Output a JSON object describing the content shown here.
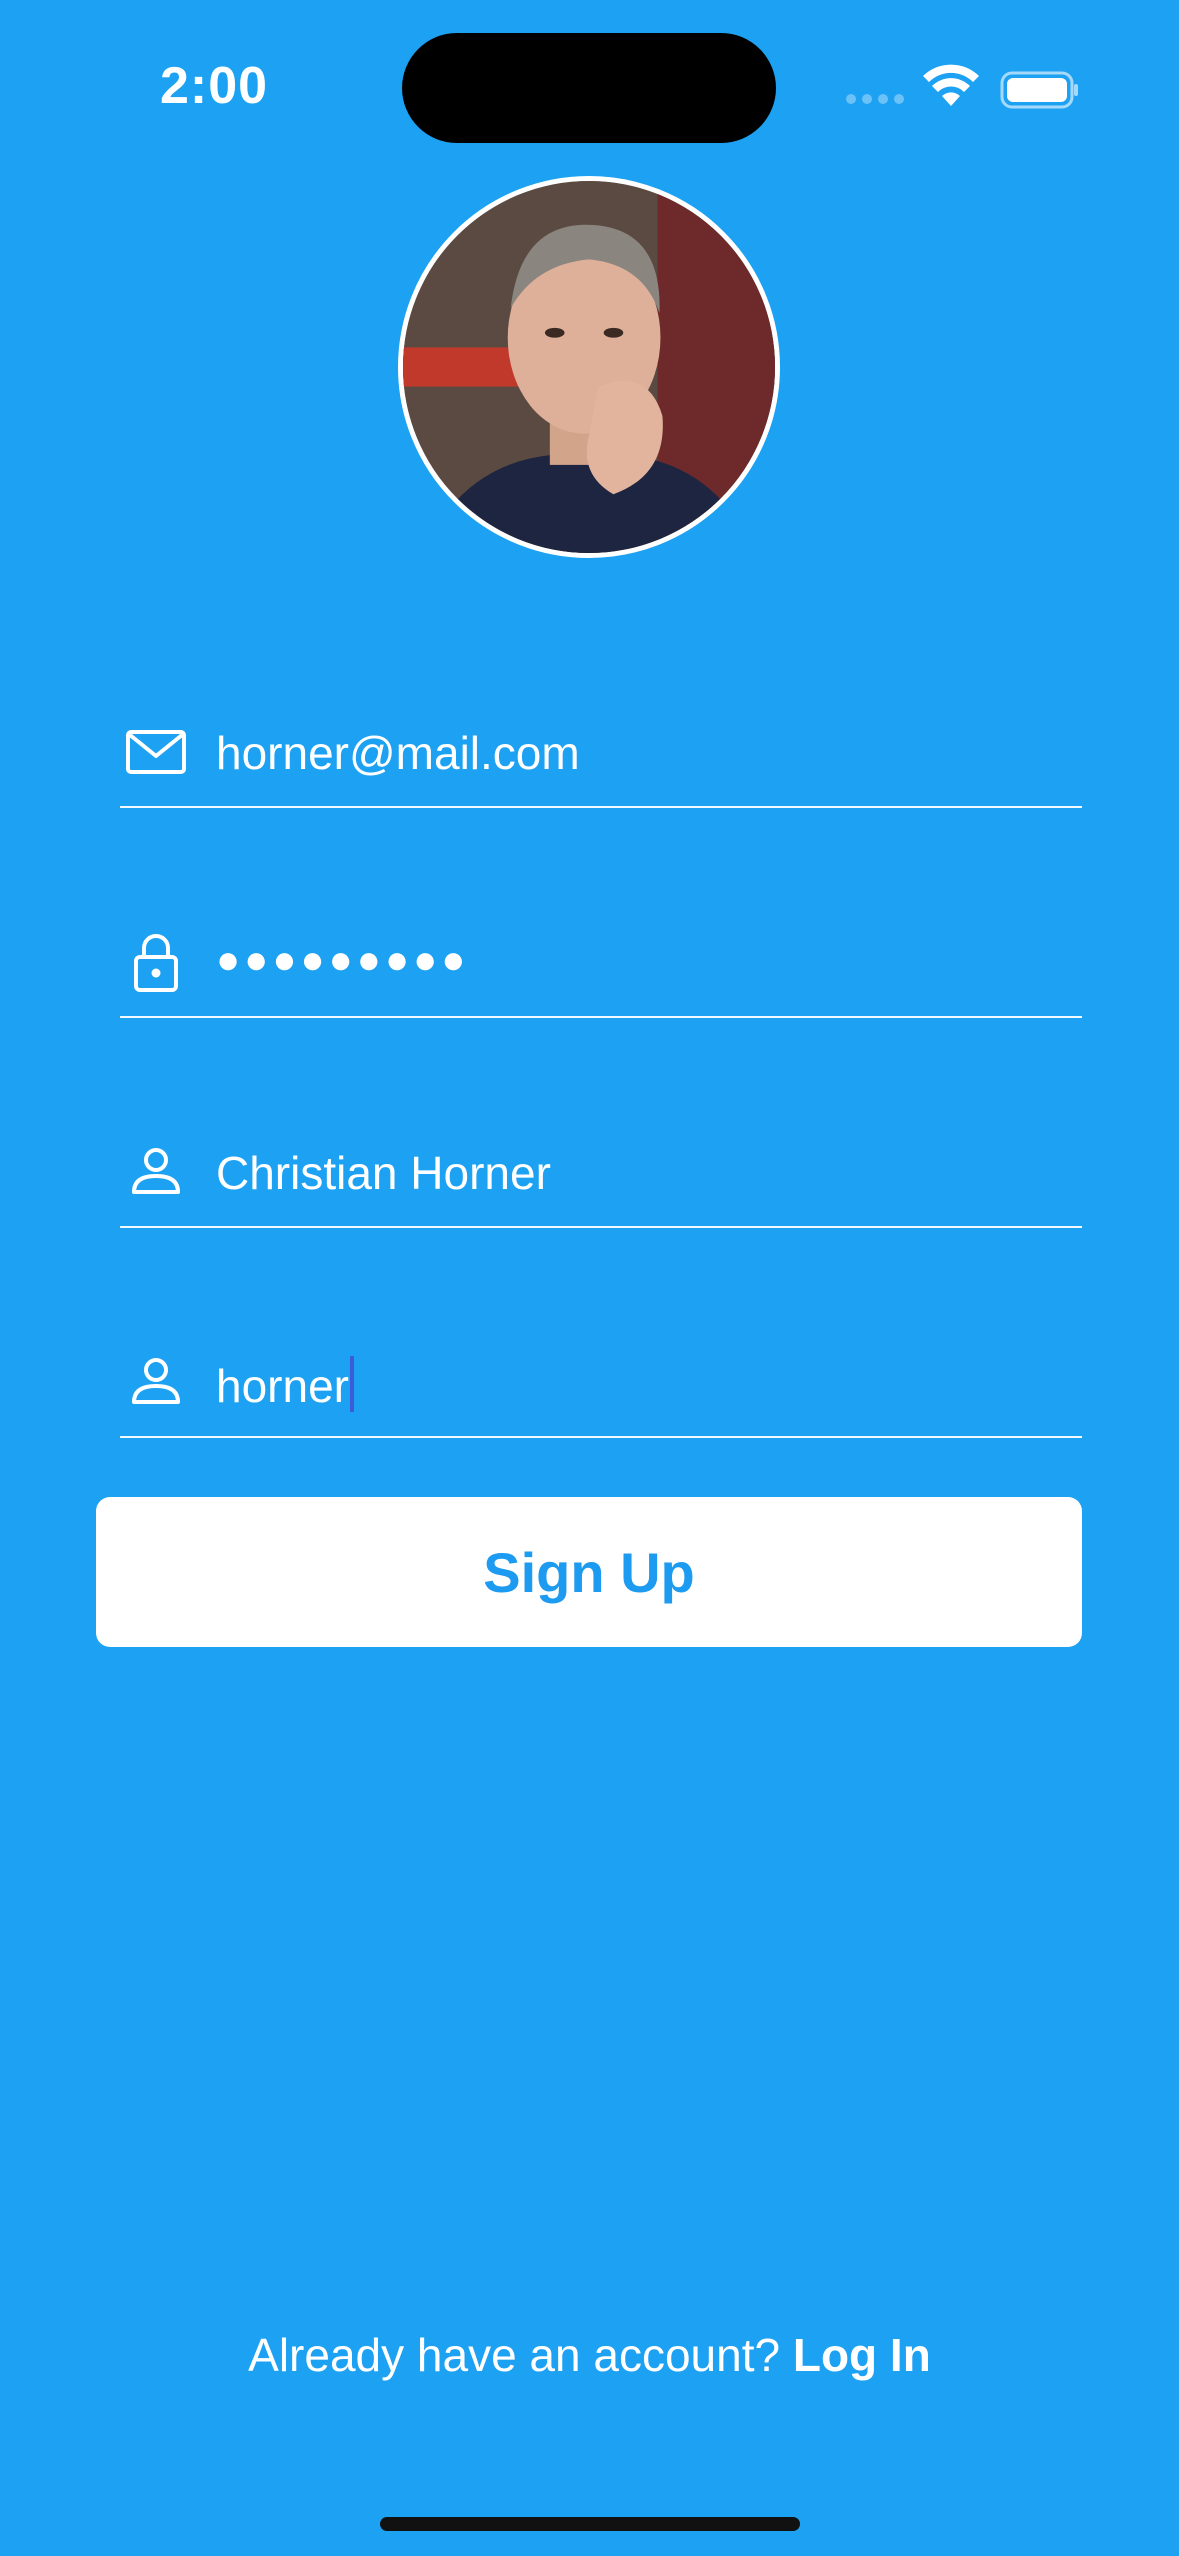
{
  "status_bar": {
    "time": "2:00"
  },
  "form": {
    "email": {
      "icon": "envelope-icon",
      "value": "horner@mail.com"
    },
    "password": {
      "icon": "lock-icon",
      "value": "●●●●●●●●●"
    },
    "full_name": {
      "icon": "person-icon",
      "value": "Christian Horner"
    },
    "username": {
      "icon": "person-icon",
      "value": "horner"
    },
    "submit_label": "Sign Up"
  },
  "footer": {
    "prompt": "Already have an account?",
    "link_label": "Log In"
  },
  "colors": {
    "background": "#1da1f2",
    "button_text": "#1d9bf0",
    "button_bg": "#ffffff"
  }
}
